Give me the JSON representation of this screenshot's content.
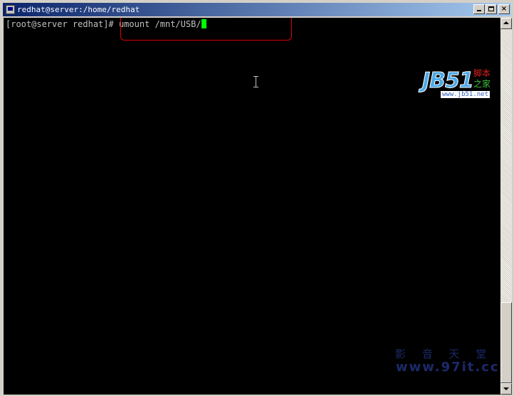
{
  "window": {
    "title": "redhat@server:/home/redhat"
  },
  "terminal": {
    "prompt": "[root@server redhat]# ",
    "command": "umount /mnt/USB/",
    "cursor_color": "#00ff00",
    "background_color": "#000000",
    "text_color": "#c0c0c0"
  },
  "annotation": {
    "highlight_color": "#e00000"
  },
  "logo": {
    "main_text": "JB51",
    "cn_line1": "脚本",
    "cn_line2": "之家",
    "url": "www.jb51.net"
  },
  "watermark": {
    "text": "影 音 天 堂",
    "url": "www.97it.cc"
  },
  "icons": {
    "minimize": "minimize-icon",
    "maximize": "maximize-icon",
    "close": "close-icon",
    "scroll_up": "arrow-up-icon",
    "scroll_down": "arrow-down-icon"
  }
}
